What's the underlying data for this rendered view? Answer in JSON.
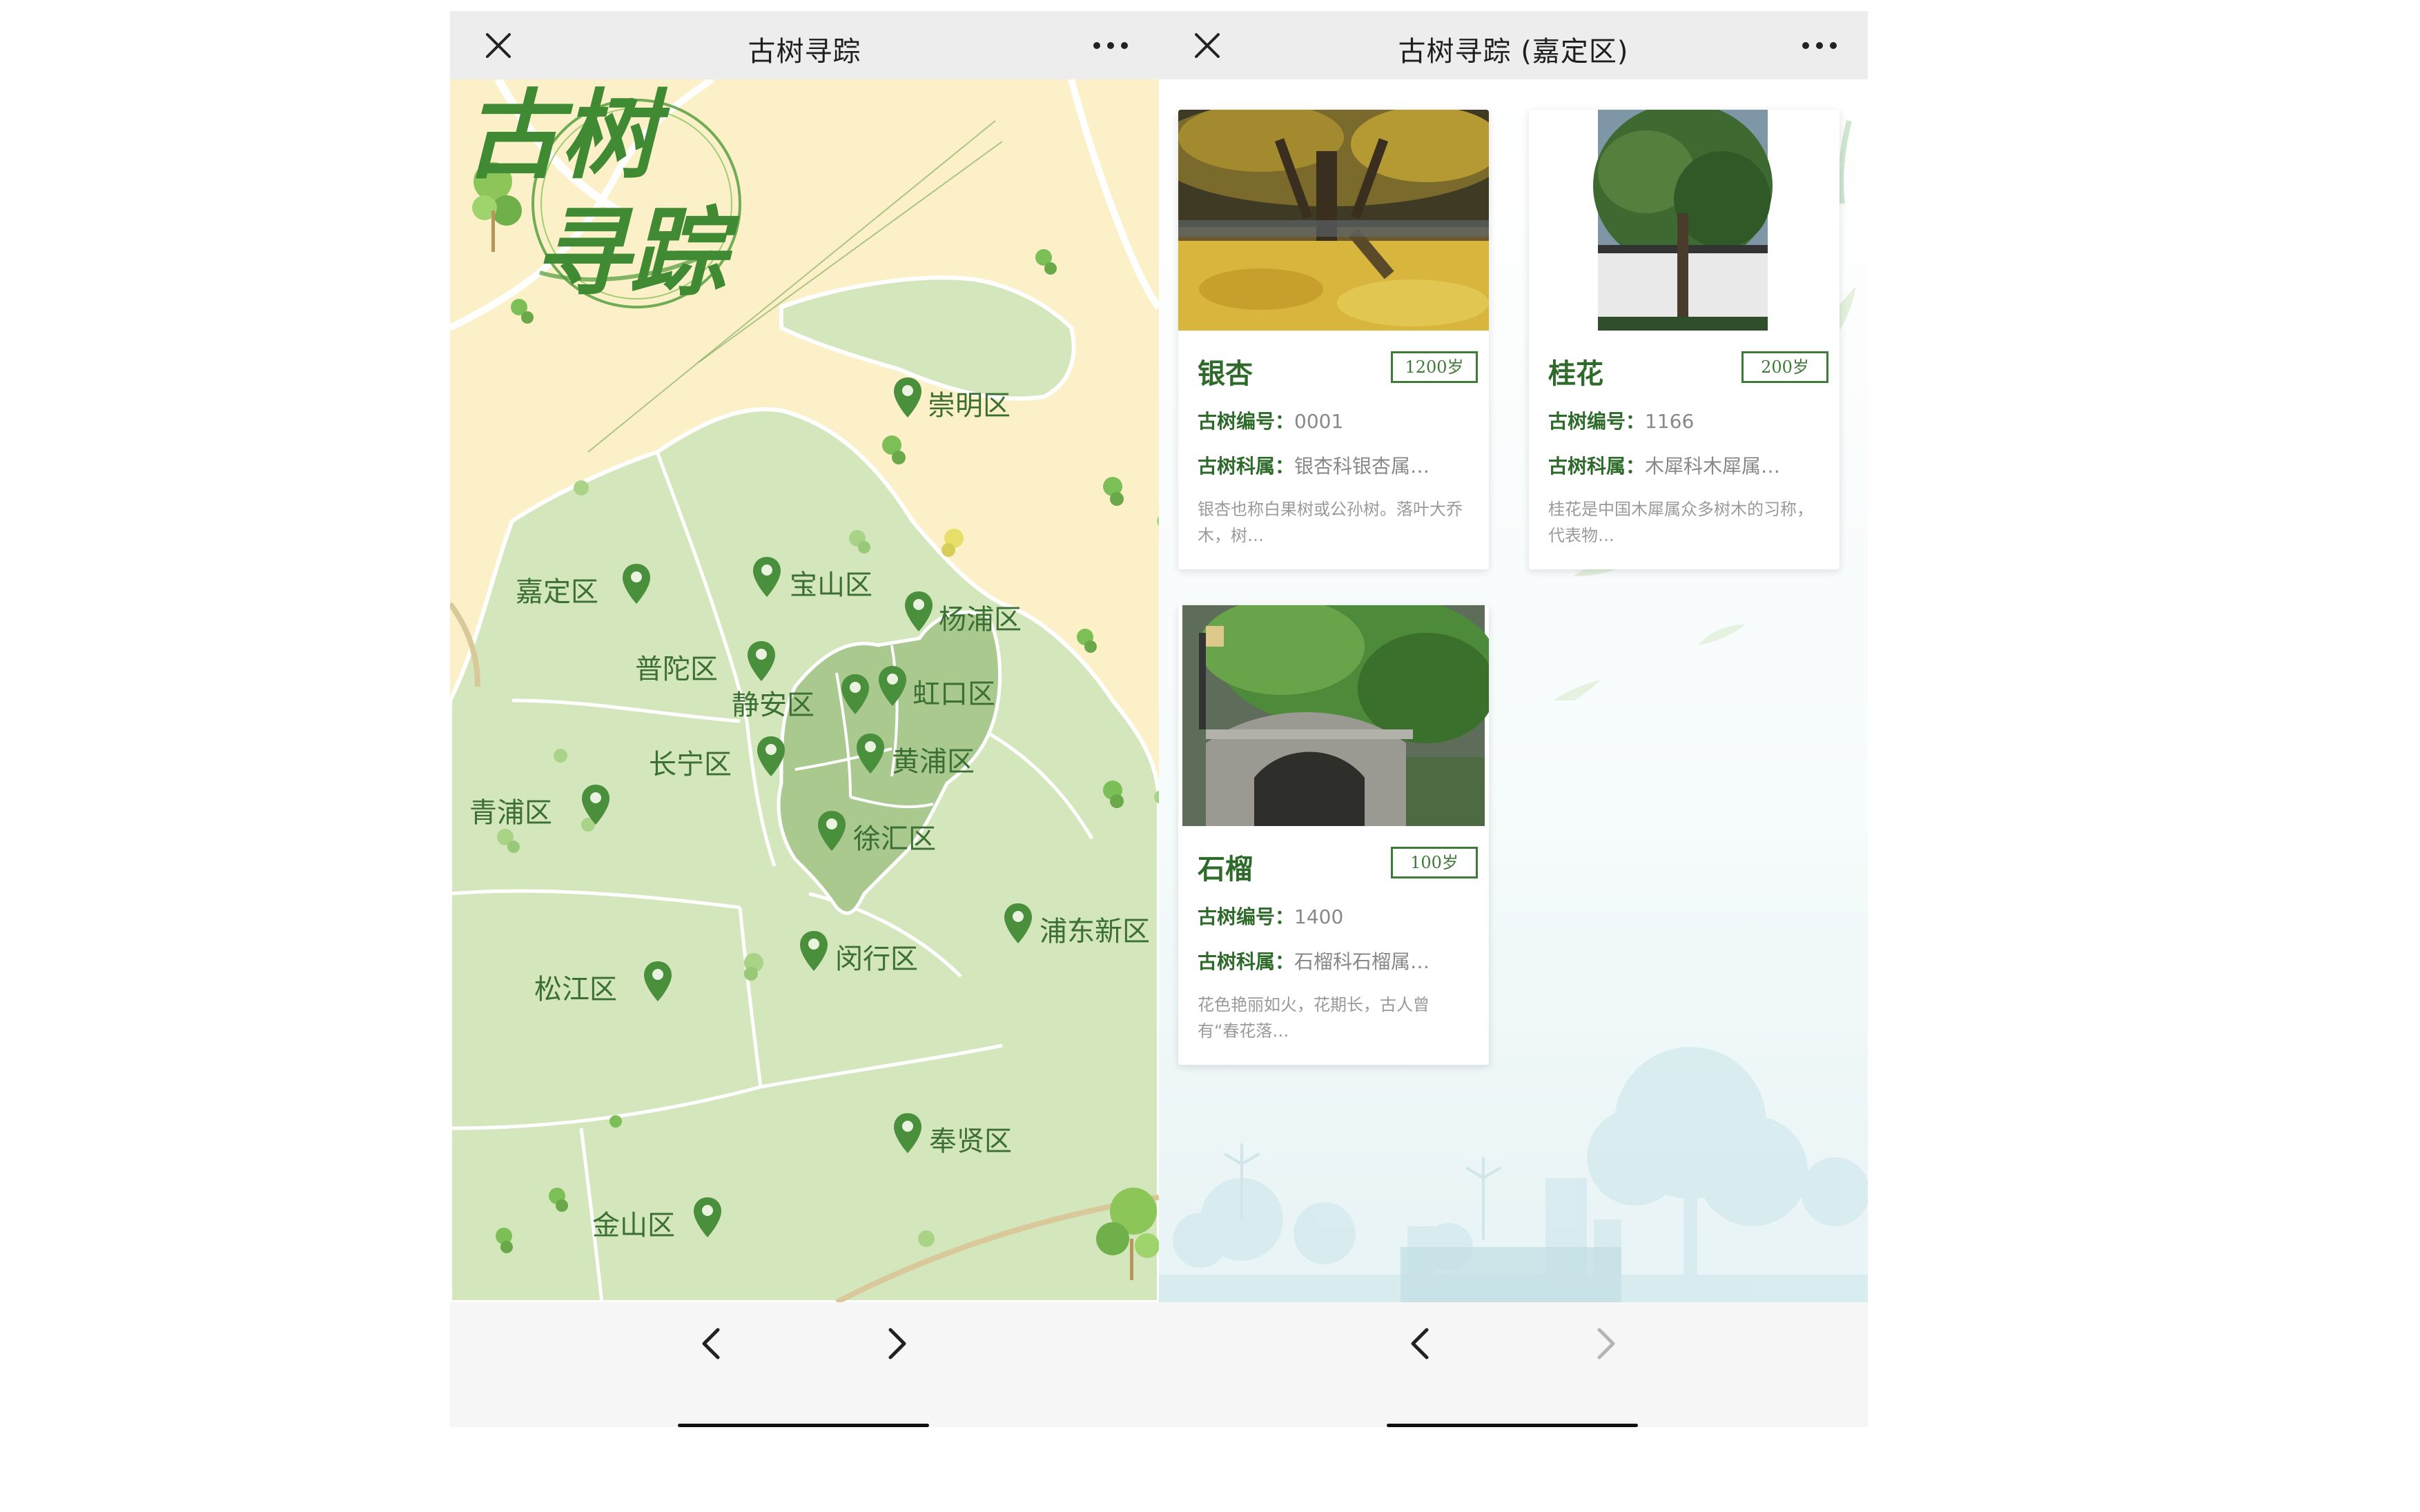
{
  "left": {
    "title": "古树寻踪",
    "districts": [
      {
        "name": "崇明区"
      },
      {
        "name": "嘉定区"
      },
      {
        "name": "宝山区"
      },
      {
        "name": "杨浦区"
      },
      {
        "name": "普陀区"
      },
      {
        "name": "静安区"
      },
      {
        "name": "虹口区"
      },
      {
        "name": "长宁区"
      },
      {
        "name": "黄浦区"
      },
      {
        "name": "青浦区"
      },
      {
        "name": "徐汇区"
      },
      {
        "name": "浦东新区"
      },
      {
        "name": "闵行区"
      },
      {
        "name": "松江区"
      },
      {
        "name": "奉贤区"
      },
      {
        "name": "金山区"
      }
    ],
    "logo_text": "古树寻踪"
  },
  "right": {
    "title": "古树寻踪 (嘉定区)",
    "cards": [
      {
        "name": "银杏",
        "age": "1200岁",
        "id_label": "古树编号：",
        "id": "0001",
        "family_label": "古树科属：",
        "family": "银杏科银杏属…",
        "desc": "银杏也称白果树或公孙树。落叶大乔木，树…"
      },
      {
        "name": "桂花",
        "age": "200岁",
        "id_label": "古树编号：",
        "id": "1166",
        "family_label": "古树科属：",
        "family": "木犀科木犀属…",
        "desc": "桂花是中国木犀属众多树木的习称，代表物…"
      },
      {
        "name": "石榴",
        "age": "100岁",
        "id_label": "古树编号：",
        "id": "1400",
        "family_label": "古树科属：",
        "family": "石榴科石榴属…",
        "desc": "花色艳丽如火，花期长，古人曾有“春花落…"
      }
    ]
  },
  "icons": {
    "close": "close-icon",
    "more": "more-dots-icon",
    "back": "chevron-left-icon",
    "forward": "chevron-right-icon",
    "pin": "map-pin-icon"
  },
  "colors": {
    "map_land": "#d4e6bb",
    "map_sea": "#fbf0c8",
    "pin": "#4a8f3c",
    "label": "#3b6f33",
    "accent": "#3f7b38"
  }
}
